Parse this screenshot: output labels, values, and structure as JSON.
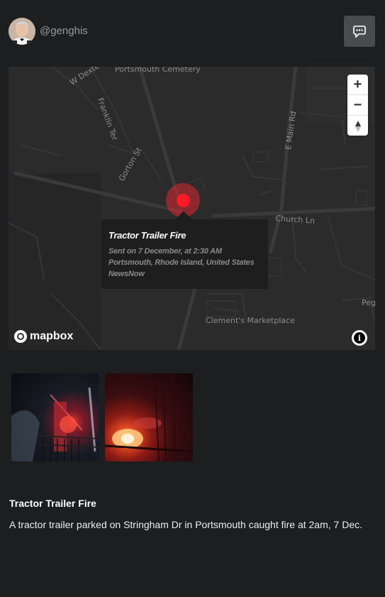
{
  "header": {
    "username": "@genghis",
    "chat_icon": "chat-bubble-icon"
  },
  "map": {
    "street_labels": {
      "w_dexter": "W Dexter",
      "portsmouth_cemetery": "Portsmouth Cemetery",
      "franklin_ter": "Franklin Ter",
      "gorton_st": "Gorton St",
      "e_main_rd": "E Main Rd",
      "church_ln": "Church Ln",
      "clements_marketplace": "Clement's Marketplace",
      "peg": "Peg"
    },
    "zoom_in": "+",
    "zoom_out": "−",
    "compass_icon": "compass-icon",
    "attribution_logo": "mapbox",
    "info_icon": "i",
    "marker": {
      "title": "Tractor Trailer Fire",
      "sent": "Sent on 7 December, at 2:30 AM",
      "location": "Portsmouth, Rhode Island, United States",
      "source": "NewsNow"
    }
  },
  "images": [
    "fire-scene-photo-1",
    "fire-scene-photo-2"
  ],
  "post": {
    "title": "Tractor Trailer Fire",
    "body": "A tractor trailer parked on Stringham Dr in Portsmouth caught fire at 2am, 7 Dec."
  },
  "colors": {
    "background": "#1d1e20",
    "map_background": "#2b2b2c",
    "marker": "#ff1a2a",
    "button": "#4a4b4f"
  }
}
